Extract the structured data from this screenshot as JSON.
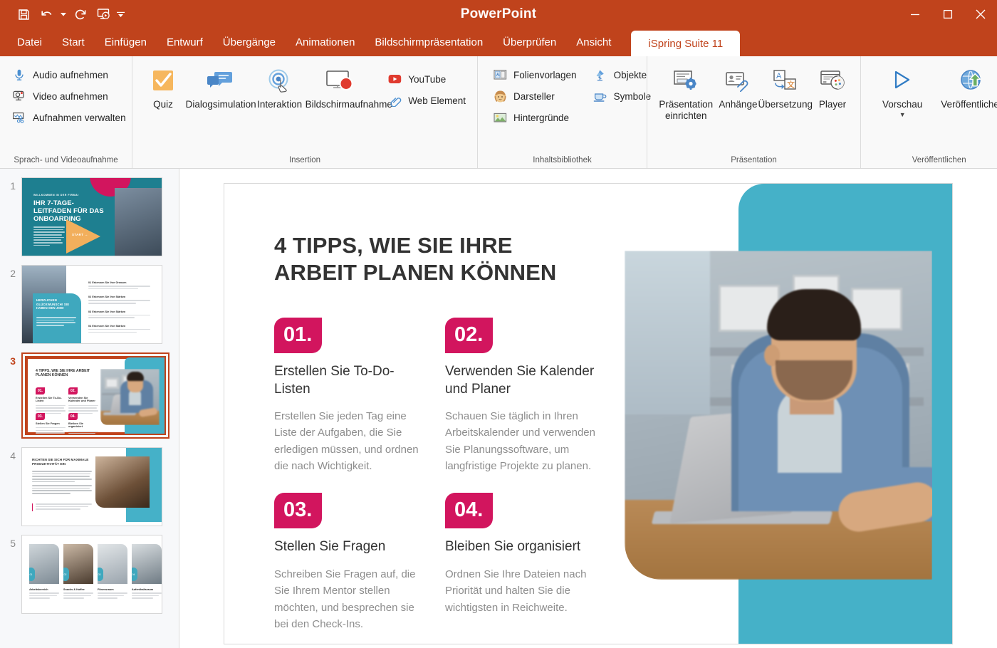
{
  "window": {
    "app_title": "PowerPoint",
    "minimize_label": "Minimieren",
    "maximize_label": "Maximieren",
    "close_label": "Schließen"
  },
  "quick_access": [
    {
      "name": "save-icon",
      "label": "Speichern"
    },
    {
      "name": "undo-icon",
      "label": "Rückgängig"
    },
    {
      "name": "redo-icon",
      "label": "Wiederholen"
    },
    {
      "name": "start-slideshow-icon",
      "label": "Von Beginn an"
    },
    {
      "name": "customize-qat-icon",
      "label": "Symbolleiste anpassen"
    }
  ],
  "tabs": [
    {
      "label": "Datei",
      "active": false
    },
    {
      "label": "Start",
      "active": false
    },
    {
      "label": "Einfügen",
      "active": false
    },
    {
      "label": "Entwurf",
      "active": false
    },
    {
      "label": "Übergänge",
      "active": false
    },
    {
      "label": "Animationen",
      "active": false
    },
    {
      "label": "Bildschirmpräsentation",
      "active": false
    },
    {
      "label": "Überprüfen",
      "active": false
    },
    {
      "label": "Ansicht",
      "active": false
    },
    {
      "label": "iSpring Suite 11",
      "active": true
    }
  ],
  "ribbon": {
    "groups": [
      {
        "label": "Sprach- und Videoaufnahme",
        "items": [
          {
            "label": "Audio aufnehmen",
            "icon": "microphone-icon"
          },
          {
            "label": "Video aufnehmen",
            "icon": "webcam-icon"
          },
          {
            "label": "Aufnahmen verwalten",
            "icon": "edit-recordings-icon"
          }
        ]
      },
      {
        "label": "Insertion",
        "big_items": [
          {
            "label": "Quiz",
            "icon": "quiz-icon"
          },
          {
            "label": "Dialogsimulation",
            "icon": "dialog-simulation-icon"
          },
          {
            "label": "Interaktion",
            "icon": "interaction-icon"
          },
          {
            "label": "Bildschirmaufnahme",
            "icon": "screen-recording-icon"
          }
        ],
        "small_items": [
          {
            "label": "YouTube",
            "icon": "youtube-icon"
          },
          {
            "label": "Web Element",
            "icon": "web-element-icon"
          }
        ]
      },
      {
        "label": "Inhaltsbibliothek",
        "col1": [
          {
            "label": "Folienvorlagen",
            "icon": "slide-templates-icon"
          },
          {
            "label": "Darsteller",
            "icon": "characters-icon"
          },
          {
            "label": "Hintergründe",
            "icon": "backgrounds-icon"
          }
        ],
        "col2": [
          {
            "label": "Objekte",
            "icon": "objects-icon"
          },
          {
            "label": "Symbole",
            "icon": "icons-icon"
          }
        ]
      },
      {
        "label": "Präsentation",
        "big_items": [
          {
            "label": "Präsentation einrichten",
            "icon": "presentation-setup-icon"
          },
          {
            "label": "Anhänge",
            "icon": "attachments-icon"
          },
          {
            "label": "Übersetzung",
            "icon": "translation-icon"
          },
          {
            "label": "Player",
            "icon": "player-icon"
          }
        ]
      },
      {
        "label": "Veröffentlichen",
        "big_items": [
          {
            "label": "Vorschau",
            "icon": "preview-play-icon",
            "has_dropdown": true
          },
          {
            "label": "Veröffentlichen",
            "icon": "publish-globe-icon"
          }
        ]
      }
    ]
  },
  "thumbnails": [
    {
      "number": "1",
      "selected": false
    },
    {
      "number": "2",
      "selected": false
    },
    {
      "number": "3",
      "selected": true
    },
    {
      "number": "4",
      "selected": false
    },
    {
      "number": "5",
      "selected": false
    }
  ],
  "slide1": {
    "kicker": "WILLKOMMEN IN DER FIRMA!",
    "title": "IHR 7-TAGE-LEITFADEN FÜR DAS ONBOARDING",
    "cta": "START →"
  },
  "slide2": {
    "card_title": "HERZLICHEN GLÜCKWUNSCH! SIE HABEN DEN JOB!",
    "list": [
      {
        "num": "01",
        "head": "Erkennen Sie Ihre Grenzen"
      },
      {
        "num": "02",
        "head": "Erkennen Sie Ihre Stärken"
      },
      {
        "num": "03",
        "head": "Erkennen Sie Ihre Stärken"
      },
      {
        "num": "04",
        "head": "Erkennen Sie Ihre Stärken"
      }
    ]
  },
  "slide3": {
    "title": "4 TIPPS, WIE SIE IHRE ARBEIT PLANEN KÖNNEN",
    "tips": [
      {
        "badge": "01.",
        "head": "Erstellen Sie To-Do-Listen",
        "body": "Erstellen Sie jeden Tag eine Liste der Aufgaben, die Sie erledigen müssen, und ordnen die nach Wichtigkeit."
      },
      {
        "badge": "02.",
        "head": "Verwenden Sie Kalender und Planer",
        "body": "Schauen Sie täglich in Ihren Arbeitskalender und verwenden Sie Planungssoftware, um langfristige Projekte zu planen."
      },
      {
        "badge": "03.",
        "head": "Stellen Sie Fragen",
        "body": "Schreiben Sie Fragen auf, die Sie Ihrem Mentor stellen möchten, und besprechen sie bei den Check-Ins."
      },
      {
        "badge": "04.",
        "head": "Bleiben Sie organisiert",
        "body": "Ordnen Sie Ihre Dateien nach Priorität und halten Sie die wichtigsten in Reichweite."
      }
    ]
  },
  "slide4": {
    "title": "RICHTEN SIE SICH FÜR MAXIMALE PRODUKTIVITÄT EIN"
  },
  "slide5": {
    "cards": [
      {
        "num": "01",
        "label": "Arbeitsbereich"
      },
      {
        "num": "02",
        "label": "Snacks & Kaffee"
      },
      {
        "num": "03",
        "label": "Fitnessraum"
      },
      {
        "num": "04",
        "label": "Aufenthaltsraum"
      }
    ]
  },
  "colors": {
    "ribbon_accent": "#C0431C",
    "badge_pink": "#D2155E",
    "teal": "#45B1C8",
    "teal_dark": "#1E7F90",
    "orange": "#F2AF5C"
  }
}
